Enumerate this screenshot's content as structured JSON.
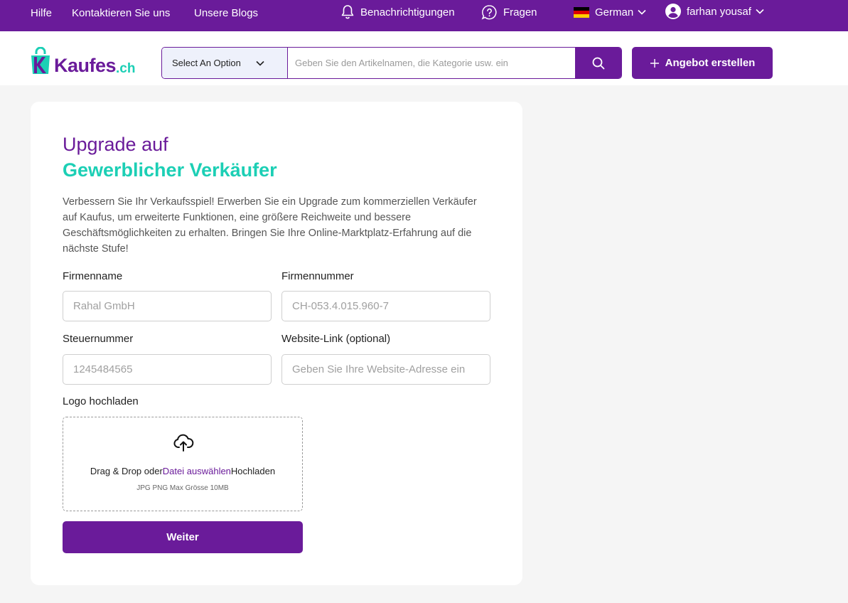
{
  "topbar": {
    "links": [
      "Hilfe",
      "Kontaktieren Sie uns",
      "Unsere Blogs"
    ],
    "notifications": "Benachrichtigungen",
    "questions": "Fragen",
    "language": "German",
    "user": "farhan yousaf"
  },
  "header": {
    "logo_main": "Kaufes",
    "logo_suffix": ".ch",
    "search_select": "Select An Option",
    "search_placeholder": "Geben Sie den Artikelnamen, die Kategorie usw. ein",
    "create_offer": "Angebot erstellen"
  },
  "form": {
    "title_line1": "Upgrade auf",
    "title_line2": "Gewerblicher Verkäufer",
    "description": "Verbessern Sie Ihr Verkaufsspiel! Erwerben Sie ein Upgrade zum kommerziellen Verkäufer auf Kaufus, um erweiterte Funktionen, eine größere Reichweite und bessere Geschäftsmöglichkeiten zu erhalten. Bringen Sie Ihre Online-Marktplatz-Erfahrung auf die nächste Stufe!",
    "company_name_label": "Firmenname",
    "company_name_placeholder": "Rahal GmbH",
    "company_number_label": "Firmennummer",
    "company_number_placeholder": "CH-053.4.015.960-7",
    "tax_number_label": "Steuernummer",
    "tax_number_placeholder": "1245484565",
    "website_label": "Website-Link (optional)",
    "website_placeholder": "Geben Sie Ihre Website-Adresse ein",
    "logo_label": "Logo hochladen",
    "upload_text_before": "Drag & Drop oder",
    "upload_link": "Datei auswählen",
    "upload_text_after": "Hochladen",
    "upload_hint": "JPG PNG Max Grösse 10MB",
    "next_button": "Weiter"
  },
  "colors": {
    "primary": "#6a1b9a",
    "accent": "#1ccfb5"
  }
}
